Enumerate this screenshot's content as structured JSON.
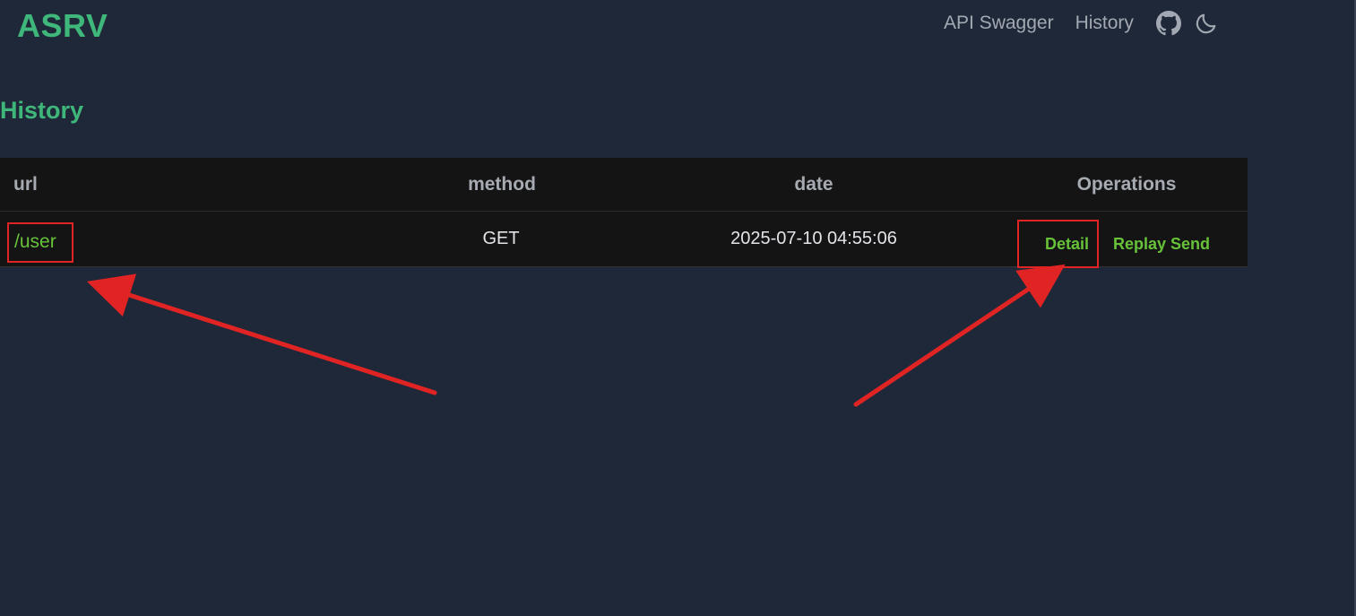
{
  "header": {
    "brand": "ASRV",
    "nav": {
      "swagger_label": "API Swagger",
      "history_label": "History",
      "github_icon": "github-icon",
      "theme_icon": "moon-icon"
    }
  },
  "main": {
    "title": "History",
    "table": {
      "columns": [
        "url",
        "method",
        "date",
        "Operations"
      ],
      "rows": [
        {
          "url": "/user",
          "method": "GET",
          "date": "2025-07-10 04:55:06",
          "actions": [
            "Detail",
            "Replay Send"
          ]
        }
      ]
    }
  },
  "colors": {
    "background": "#1f2839",
    "accent": "#3fb67a",
    "link": "#67c23a",
    "table_bg": "#141414",
    "annotation": "#e02424"
  }
}
